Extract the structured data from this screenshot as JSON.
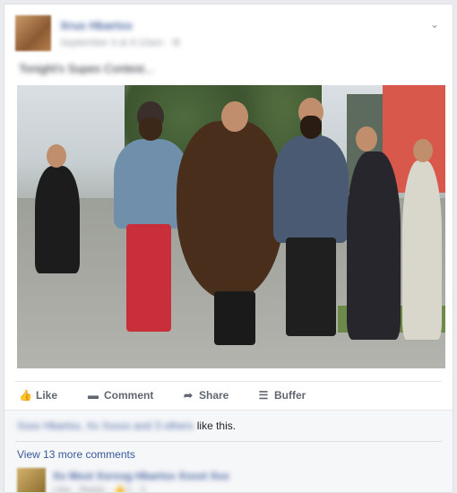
{
  "post": {
    "author": "Xrus Hbartxx",
    "meta": "September 4 at 9:10am · ⚙",
    "status_text": "Tonight's Supes Contest..."
  },
  "actions": {
    "like": "Like",
    "comment": "Comment",
    "share": "Share",
    "buffer": "Buffer"
  },
  "likes": {
    "names": "Xxxx Hbartxx, Xx Xxxxx and 3 others",
    "suffix": "like this."
  },
  "comments": {
    "view_more": "View 13 more comments",
    "first": {
      "name": "Xx Mxxt Xxrxxg Hbartxx Xxxxt Xxx",
      "meta": "Like · Reply · 👍1 · 2"
    }
  },
  "icons": {
    "chevron": "chevron-down-icon",
    "like": "thumbs-up-icon",
    "comment": "comment-icon",
    "share": "share-arrow-icon",
    "buffer": "buffer-stack-icon"
  },
  "colors": {
    "link": "#365899",
    "action_text": "#606770",
    "background": "#e9ebee"
  }
}
